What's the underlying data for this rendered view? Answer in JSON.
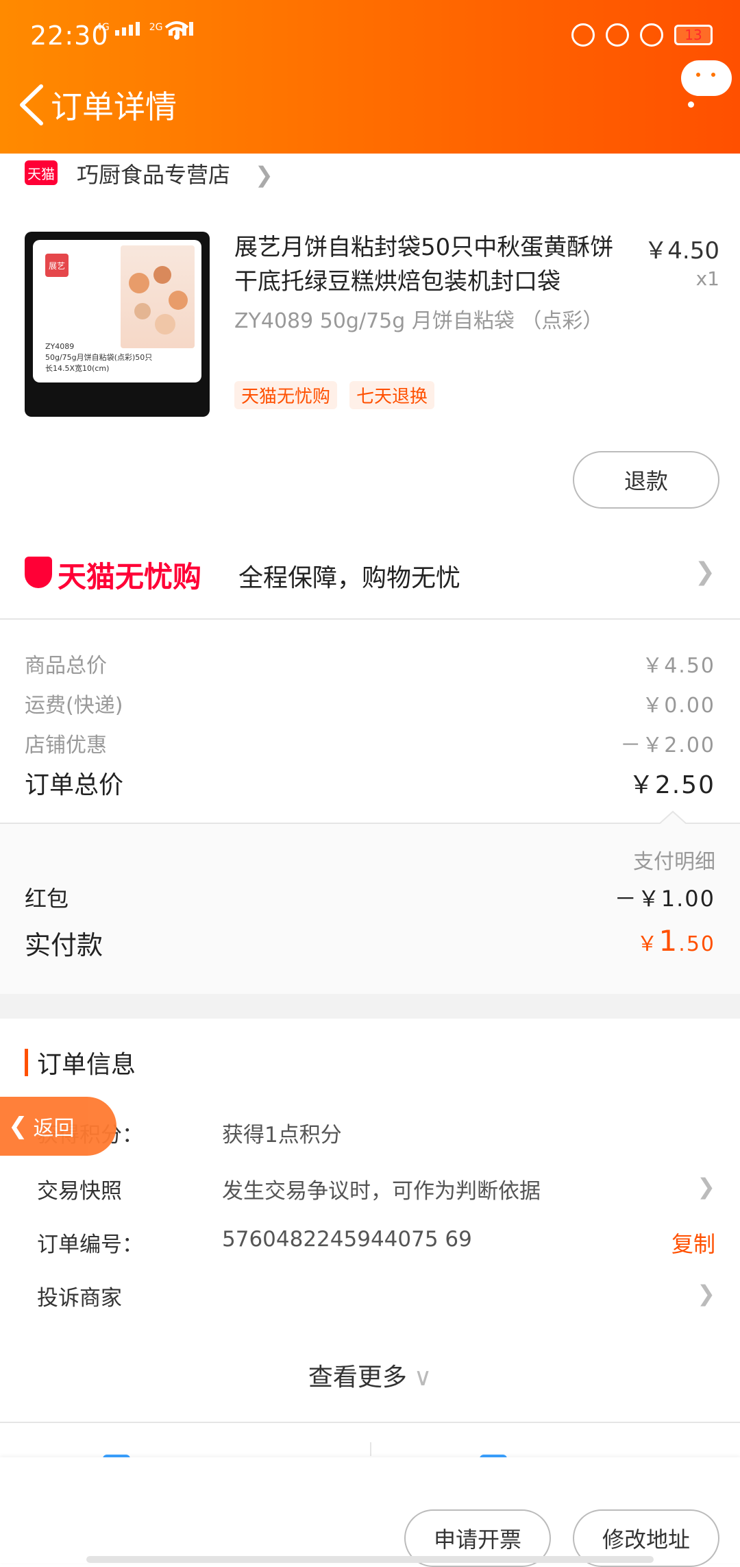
{
  "status_bar": {
    "time": "22:30",
    "net1": "4G",
    "net2": "2G",
    "battery": "13"
  },
  "header": {
    "title": "订单详情"
  },
  "shop": {
    "badge": "天猫",
    "name": "巧厨食品专营店"
  },
  "product": {
    "title": "展艺月饼自粘封袋50只中秋蛋黄酥饼干底托绿豆糕烘焙包装机封口袋",
    "price": "￥4.50",
    "qty": "x1",
    "sku": "ZY4089 50g/75g 月饼自粘袋 （点彩）",
    "image_logo": "展艺",
    "image_caption": "ZY4089\n50g/75g月饼自粘袋(点彩)50只\n长14.5X宽10(cm)",
    "tags": [
      "天猫无忧购",
      "七天退换"
    ],
    "refund_label": "退款"
  },
  "guarantee": {
    "brand": "天猫无忧购",
    "text": "全程保障，购物无忧"
  },
  "price_rows": [
    {
      "label": "商品总价",
      "value": "￥4.50"
    },
    {
      "label": "运费(快递)",
      "value": "￥0.00"
    },
    {
      "label": "店铺优惠",
      "value": "－￥2.00"
    }
  ],
  "total": {
    "label": "订单总价",
    "value": "￥2.50"
  },
  "payment": {
    "detail_label": "支付明细",
    "red_packet_label": "红包",
    "red_packet_value": "－￥1.00",
    "actual_label": "实付款",
    "actual_symbol": "￥",
    "actual_int": "1",
    "actual_dec": ".50"
  },
  "order_info": {
    "title": "订单信息",
    "points_label": "获得积分：",
    "points_value": "获得1点积分",
    "snapshot_label": "交易快照",
    "snapshot_value": "发生交易争议时，可作为判断依据",
    "order_no_label": "订单编号：",
    "order_no_value": "5760482245944075 69",
    "copy_label": "复制",
    "complain_label": "投诉商家",
    "see_more": "查看更多"
  },
  "float_back": "返回",
  "bottom": {
    "invoice": "申请开票",
    "address": "修改地址"
  },
  "colors": {
    "accent": "#ff5000",
    "header_start": "#ff8a00",
    "header_end": "#ff5000",
    "tmall_red": "#ff0036"
  }
}
